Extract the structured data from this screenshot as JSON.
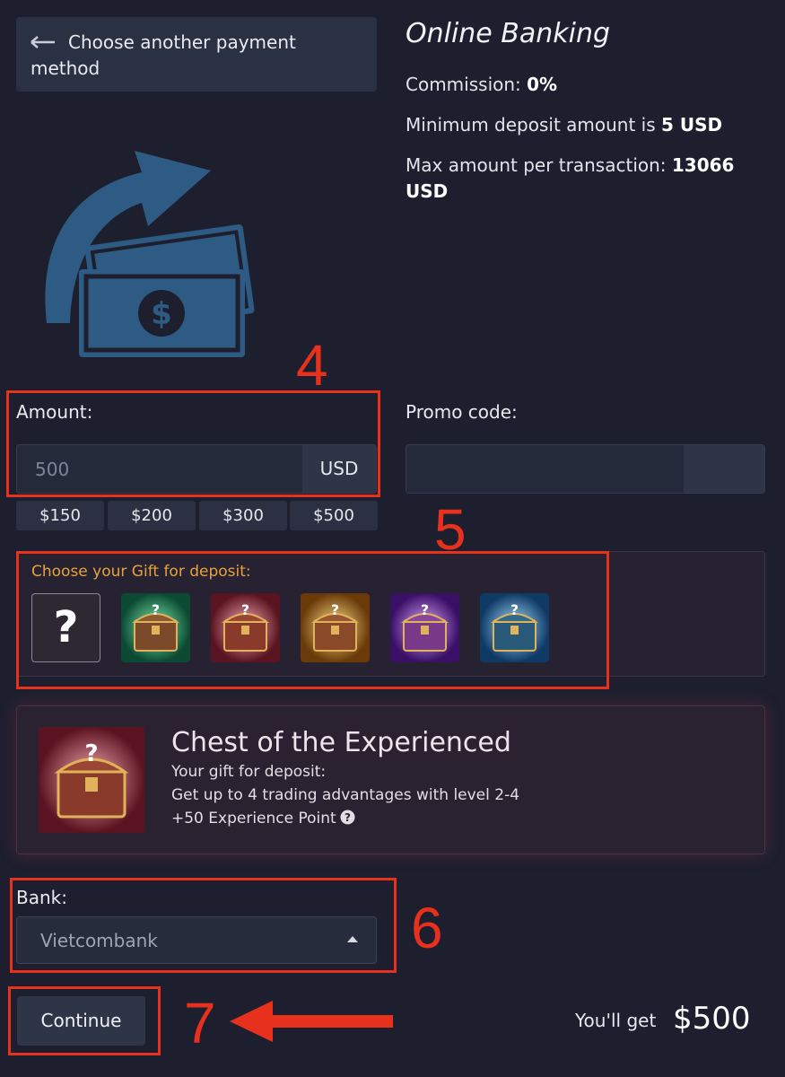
{
  "back": {
    "label": "Choose another payment method"
  },
  "method": {
    "title": "Online Banking",
    "commission_label": "Commission:",
    "commission_value": "0%",
    "min_label": "Minimum deposit amount is",
    "min_value": "5 USD",
    "max_label": "Max amount per transaction:",
    "max_value_line1": "13066",
    "max_value_line2": "USD"
  },
  "amount": {
    "label": "Amount:",
    "placeholder": "500",
    "currency": "USD",
    "presets": [
      "$150",
      "$200",
      "$300",
      "$500"
    ]
  },
  "promo": {
    "label": "Promo code:",
    "value": ""
  },
  "gifts": {
    "title": "Choose your Gift for deposit:",
    "options": [
      {
        "name": "random",
        "icon": "?"
      },
      {
        "name": "green-chest",
        "color": "#1e9a6a"
      },
      {
        "name": "red-chest",
        "color": "#c23e55"
      },
      {
        "name": "orange-chest",
        "color": "#d88a1e"
      },
      {
        "name": "purple-chest",
        "color": "#8a3cc8"
      },
      {
        "name": "blue-chest",
        "color": "#2a7fd4"
      }
    ]
  },
  "selected_gift": {
    "title": "Chest of the Experienced",
    "line1": "Your gift for deposit:",
    "line2": "Get up to 4 trading advantages with level 2-4",
    "line3": "+50 Experience Point"
  },
  "bank": {
    "label": "Bank:",
    "value": "Vietcombank"
  },
  "continue_label": "Continue",
  "you_get": {
    "label": "You'll get",
    "value": "$500"
  },
  "annotations": [
    "4",
    "5",
    "6",
    "7"
  ],
  "colors": {
    "background": "#1d1f2e",
    "accent_orange": "#e8a23c",
    "annotation_red": "#e8311c",
    "illustration_blue": "#2d5b83"
  }
}
